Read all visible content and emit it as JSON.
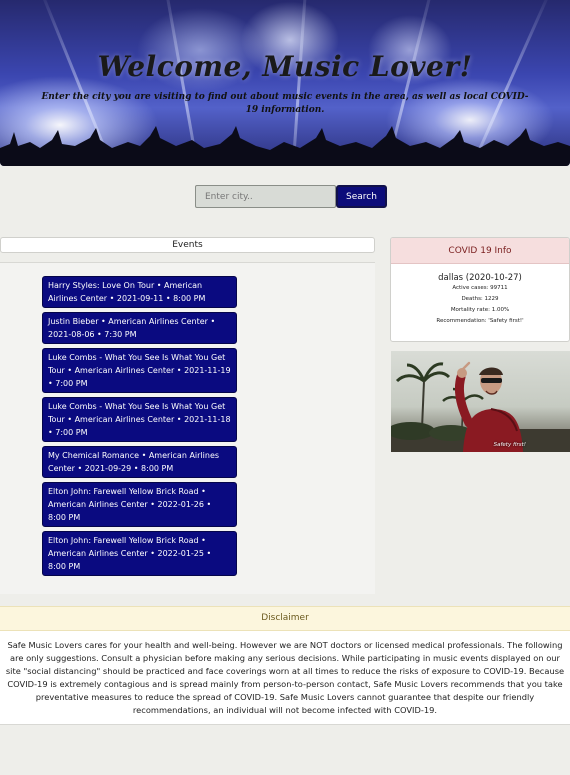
{
  "hero": {
    "title": "Welcome, Music Lover!",
    "subtitle": "Enter the city you are visiting to find out about music events in the area, as well as local COVID-19 information."
  },
  "search": {
    "placeholder": "Enter city..",
    "value": "",
    "button_label": "Search"
  },
  "events": {
    "header": "Events",
    "items": [
      {
        "text": "Harry Styles: Love On Tour • American Airlines Center • 2021-09-11 • 8:00 PM"
      },
      {
        "text": "Justin Bieber • American Airlines Center • 2021-08-06 • 7:30 PM"
      },
      {
        "text": "Luke Combs - What You See Is What You Get Tour • American Airlines Center • 2021-11-19 • 7:00 PM"
      },
      {
        "text": "Luke Combs - What You See Is What You Get Tour • American Airlines Center • 2021-11-18 • 7:00 PM"
      },
      {
        "text": "My Chemical Romance • American Airlines Center • 2021-09-29 • 8:00 PM"
      },
      {
        "text": "Elton John: Farewell Yellow Brick Road • American Airlines Center • 2022-01-26 • 8:00 PM"
      },
      {
        "text": "Elton John: Farewell Yellow Brick Road • American Airlines Center • 2022-01-25 • 8:00 PM"
      }
    ]
  },
  "covid": {
    "header": "COVID 19 Info",
    "city": "dallas (2020-10-27)",
    "active_cases": "Active cases: 99711",
    "deaths": "Deaths: 1229",
    "mortality": "Mortality rate: 1.00%",
    "recommendation": "Recommendation: 'Safety first!'"
  },
  "gif": {
    "caption": "Safety first!"
  },
  "disclaimer": {
    "header": "Disclaimer",
    "body": "Safe Music Lovers cares for your health and well-being. However we are NOT doctors or licensed medical professionals. The following are only suggestions. Consult a physician before making any serious decisions. While participating in music events displayed on our site \"social distancing\" should be practiced and face coverings worn at all times to reduce the risks of exposure to COVID-19. Because COVID-19 is extremely contagious and is spread mainly from person-to-person contact, Safe Music Lovers recommends that you take preventative measures to reduce the spread of COVID-19. Safe Music Lovers cannot guarantee that despite our friendly recommendations, an individual will not become infected with COVID-19."
  },
  "colors": {
    "event_card_bg": "#0a0a80",
    "search_button_bg": "#0c0c7a",
    "covid_header_bg": "#f6dede",
    "disclaimer_header_bg": "#fcf6dd"
  }
}
